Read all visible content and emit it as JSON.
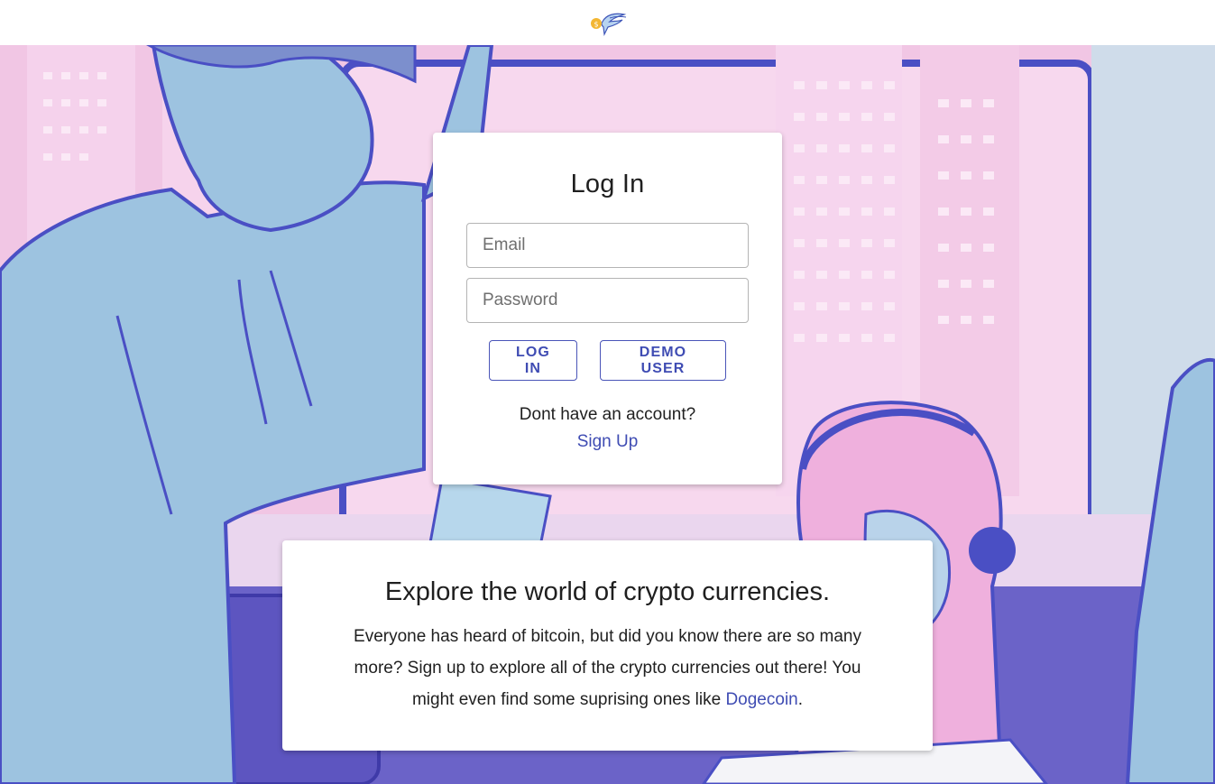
{
  "header": {
    "logo_icon": "hummingbird-coin-logo-icon"
  },
  "login": {
    "title": "Log In",
    "email_placeholder": "Email",
    "password_placeholder": "Password",
    "login_button": "LOG IN",
    "demo_button": "DEMO USER",
    "no_account_text": "Dont have an account?",
    "signup_link": "Sign Up"
  },
  "explore": {
    "title": "Explore the world of crypto currencies.",
    "body": "Everyone has heard of bitcoin, but did you know there are so many more? Sign up to explore all of the crypto currencies out there! You might even find some suprising ones like",
    "link_text": "Dogecoin",
    "trailing": "."
  },
  "colors": {
    "accent": "#3f4cb3",
    "background_pink": "#f3c8e6",
    "background_blue": "#9dc3e0",
    "line_purple": "#4a4fc4"
  }
}
